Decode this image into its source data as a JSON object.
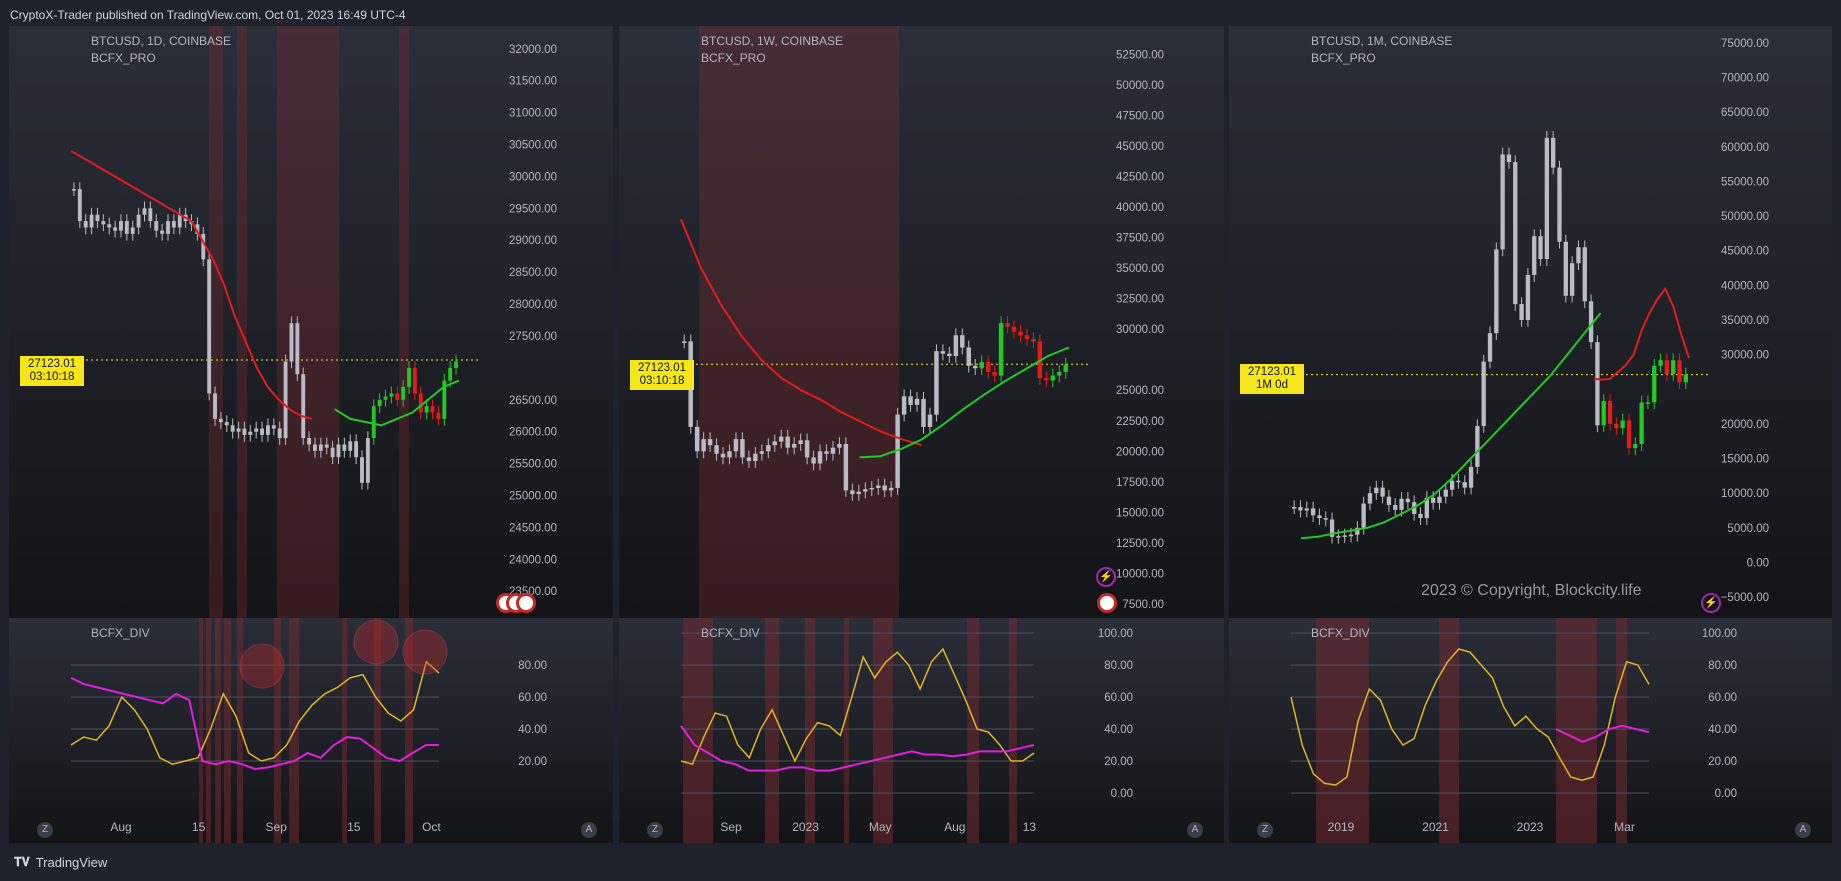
{
  "header": {
    "text": "CryptoX-Trader published on TradingView.com, Oct 01, 2023 16:49 UTC-4"
  },
  "footer": {
    "brand": "TradingView",
    "logo": "tradingview-logo"
  },
  "panels": [
    {
      "symbol": "BTCUSD, 1D, COINBASE",
      "indicator": "BCFX_PRO",
      "div_label": "BCFX_DIV",
      "last_price": "27123.01",
      "countdown": "03:10:18",
      "price_ticks": [
        "32000.00",
        "31500.00",
        "31000.00",
        "30500.00",
        "30000.00",
        "29500.00",
        "29000.00",
        "28500.00",
        "28000.00",
        "27500.00",
        "26500.00",
        "26000.00",
        "25500.00",
        "25000.00",
        "24500.00",
        "24000.00",
        "23500.00"
      ],
      "div_ticks": [
        "80.00",
        "60.00",
        "40.00",
        "20.00"
      ],
      "time_ticks": [
        "Aug",
        "15",
        "Sep",
        "15",
        "Oct"
      ],
      "z_btn": "Z",
      "a_btn": "A"
    },
    {
      "symbol": "BTCUSD, 1W, COINBASE",
      "indicator": "BCFX_PRO",
      "div_label": "BCFX_DIV",
      "last_price": "27123.01",
      "countdown": "03:10:18",
      "price_ticks": [
        "52500.00",
        "50000.00",
        "47500.00",
        "45000.00",
        "42500.00",
        "40000.00",
        "37500.00",
        "35000.00",
        "32500.00",
        "30000.00",
        "25000.00",
        "22500.00",
        "20000.00",
        "17500.00",
        "15000.00",
        "12500.00",
        "10000.00",
        "7500.00"
      ],
      "div_ticks": [
        "100.00",
        "80.00",
        "60.00",
        "40.00",
        "20.00",
        "0.00"
      ],
      "time_ticks": [
        "Sep",
        "2023",
        "May",
        "Aug",
        "13"
      ],
      "z_btn": "Z",
      "a_btn": "A"
    },
    {
      "symbol": "BTCUSD, 1M, COINBASE",
      "indicator": "BCFX_PRO",
      "div_label": "BCFX_DIV",
      "last_price": "27123.01",
      "countdown": "1M 0d",
      "copyright": "2023 © Copyright, Blockcity.life",
      "price_ticks": [
        "75000.00",
        "70000.00",
        "65000.00",
        "60000.00",
        "55000.00",
        "50000.00",
        "45000.00",
        "40000.00",
        "35000.00",
        "30000.00",
        "20000.00",
        "15000.00",
        "10000.00",
        "5000.00",
        "0.00",
        "−5000.00"
      ],
      "div_ticks": [
        "100.00",
        "80.00",
        "60.00",
        "40.00",
        "20.00",
        "0.00"
      ],
      "time_ticks": [
        "2019",
        "2021",
        "2023",
        "Mar"
      ],
      "z_btn": "Z",
      "a_btn": "A"
    }
  ],
  "chart_data": [
    {
      "type": "candlestick",
      "title": "BTCUSD, 1D, COINBASE",
      "x_labels": [
        "Aug",
        "15",
        "Sep",
        "15",
        "Oct"
      ],
      "ylim": [
        23300,
        32200
      ],
      "last_price": 27123.01,
      "closes": [
        29800,
        29300,
        29200,
        29400,
        29300,
        29250,
        29200,
        29150,
        29300,
        29100,
        29200,
        29400,
        29500,
        29300,
        29150,
        29100,
        29300,
        29200,
        29400,
        29300,
        29250,
        29100,
        28700,
        26600,
        26200,
        26150,
        26100,
        26000,
        26050,
        25950,
        26000,
        26050,
        25950,
        26100,
        26050,
        25900,
        27100,
        27700,
        26900,
        25900,
        25800,
        25700,
        25800,
        25750,
        25600,
        25800,
        25700,
        25850,
        25600,
        25200,
        25900,
        26400,
        26500,
        26550,
        26600,
        26500,
        26700,
        27000,
        26600,
        26300,
        26400,
        26300,
        26200,
        26800,
        27000,
        27100
      ],
      "ema_red": [
        30400,
        30300,
        30200,
        30100,
        30000,
        29900,
        29800,
        29700,
        29600,
        29500,
        29400,
        29300,
        29000,
        28700,
        28300,
        27800,
        27400,
        27000,
        26700,
        26500,
        26350,
        26250,
        26200
      ],
      "ema_green": [
        26350,
        26200,
        26150,
        26100,
        26200,
        26300,
        26500,
        26700,
        26800
      ],
      "div_series": {
        "fast": [
          30,
          35,
          33,
          42,
          60,
          52,
          40,
          22,
          18,
          20,
          22,
          40,
          62,
          48,
          25,
          20,
          22,
          30,
          45,
          55,
          62,
          66,
          72,
          74,
          60,
          50,
          45,
          52,
          82,
          75
        ],
        "slow": [
          72,
          68,
          66,
          64,
          62,
          60,
          58,
          56,
          62,
          58,
          20,
          18,
          20,
          18,
          15,
          16,
          18,
          20,
          25,
          22,
          30,
          35,
          34,
          28,
          22,
          20,
          25,
          30,
          30
        ],
        "yrange": [
          0,
          100
        ]
      }
    },
    {
      "type": "candlestick",
      "title": "BTCUSD, 1W, COINBASE",
      "x_labels": [
        "Sep",
        "2023",
        "May",
        "Aug",
        "13"
      ],
      "ylim": [
        7500,
        54000
      ],
      "last_price": 27123.01,
      "closes": [
        29000,
        22000,
        20000,
        21000,
        20500,
        19800,
        19500,
        20000,
        21000,
        19500,
        19200,
        19800,
        20000,
        20500,
        20800,
        21200,
        20300,
        20600,
        20900,
        19500,
        19000,
        20000,
        19800,
        20300,
        20600,
        16800,
        16500,
        16700,
        16900,
        17000,
        17200,
        16800,
        17000,
        23000,
        24500,
        23800,
        24300,
        22000,
        23000,
        28200,
        28000,
        27800,
        29500,
        28500,
        27000,
        26800,
        27300,
        26500,
        26200,
        30500,
        30200,
        29800,
        29500,
        29200,
        29000,
        26000,
        25800,
        26200,
        26500,
        27100
      ],
      "ema_red": [
        39000,
        35000,
        32000,
        29500,
        27500,
        26000,
        25000,
        24200,
        23200,
        22400,
        21600,
        21000,
        20500
      ],
      "ema_green": [
        19500,
        19600,
        20200,
        21000,
        22200,
        23500,
        24700,
        25800,
        26800,
        27800,
        28500
      ],
      "div_series": {
        "fast": [
          20,
          18,
          35,
          50,
          48,
          30,
          22,
          40,
          52,
          36,
          20,
          34,
          44,
          42,
          36,
          60,
          85,
          72,
          82,
          88,
          80,
          65,
          82,
          90,
          74,
          58,
          40,
          38,
          30,
          20,
          20,
          25
        ],
        "slow": [
          42,
          30,
          25,
          20,
          18,
          14,
          14,
          14,
          16,
          16,
          14,
          14,
          16,
          18,
          20,
          22,
          24,
          26,
          24,
          24,
          23,
          24,
          26,
          26,
          26,
          28,
          30
        ],
        "yrange": [
          0,
          100
        ]
      }
    },
    {
      "type": "candlestick",
      "title": "BTCUSD, 1M, COINBASE",
      "x_labels": [
        "2019",
        "2021",
        "2023",
        "Mar"
      ],
      "ylim": [
        -6000,
        76000
      ],
      "last_price": 27123.01,
      "closes": [
        8000,
        7500,
        7800,
        6800,
        6400,
        6200,
        3700,
        3800,
        3900,
        4000,
        5000,
        8500,
        10000,
        10800,
        9500,
        8300,
        7600,
        9200,
        8700,
        7000,
        6400,
        9300,
        8600,
        9500,
        10500,
        11800,
        11600,
        10800,
        13800,
        19700,
        29000,
        33100,
        45200,
        58900,
        57800,
        37300,
        35000,
        41500,
        47100,
        43800,
        61300,
        57000,
        46300,
        38500,
        43200,
        45500,
        37700,
        31800,
        19800,
        23300,
        20000,
        19400,
        20500,
        16500,
        17100,
        23100,
        23100,
        28400,
        29200,
        27200,
        29200,
        26000,
        27123
      ],
      "ema_red": [
        26500,
        26400,
        26500,
        27500,
        28500,
        30000,
        33500,
        36000,
        38000,
        39500,
        37000,
        33000,
        29500
      ],
      "ema_green": [
        3500,
        3700,
        4200,
        4600,
        5000,
        5800,
        7000,
        8200,
        9800,
        12000,
        14500,
        17000,
        19500,
        22000,
        24500,
        27000,
        30000,
        33000,
        36000
      ],
      "div_series": {
        "fast": [
          60,
          30,
          12,
          6,
          5,
          10,
          45,
          65,
          58,
          40,
          30,
          34,
          55,
          70,
          82,
          90,
          88,
          80,
          72,
          54,
          42,
          48,
          40,
          35,
          22,
          10,
          8,
          10,
          30,
          60,
          82,
          80,
          68
        ],
        "slow": [
          40,
          36,
          32,
          35,
          40,
          42,
          40,
          38
        ],
        "yrange": [
          0,
          100
        ]
      }
    }
  ]
}
